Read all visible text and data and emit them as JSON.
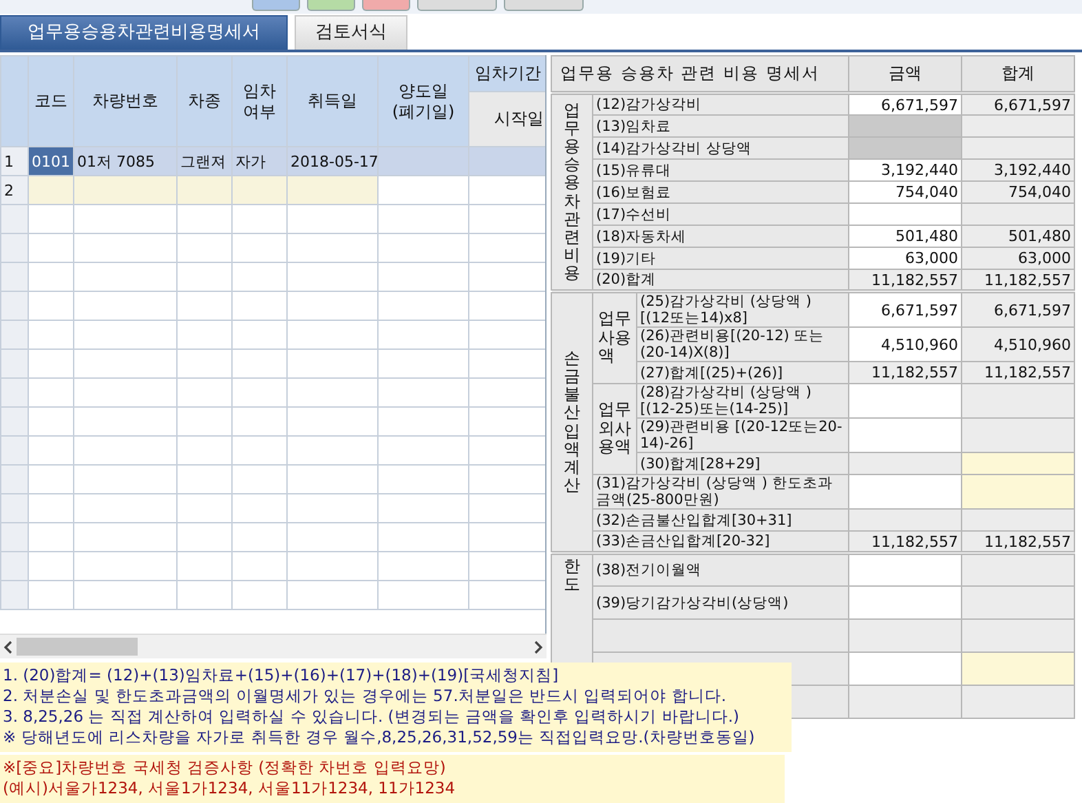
{
  "tabs": [
    {
      "label": "업무용승용차관련비용명세서",
      "selected": true
    },
    {
      "label": "검토서식",
      "selected": false
    }
  ],
  "vehicle_grid": {
    "columns": [
      "코드",
      "차량번호",
      "차종",
      "임차여부",
      "취득일",
      "양도일 (폐기일)"
    ],
    "column_group": {
      "label": "임차기간",
      "columns": [
        "시작일"
      ]
    },
    "rows": [
      {
        "number": "1",
        "selected": true,
        "new": false,
        "cells": [
          "0101",
          "01저 7085",
          "그랜져",
          "자가",
          "2018-05-17"
        ]
      },
      {
        "number": "2",
        "selected": false,
        "new": true
      }
    ]
  },
  "expense_table": {
    "title": "업무용 승용차 관련 비용 명세서",
    "columns": [
      "금액",
      "합계"
    ],
    "sections": [
      {
        "label": "업무용 승용차 관련 비용",
        "items": [
          {
            "label": "(12)감가상각비",
            "amount": {
              "kind": "input",
              "value": "6,671,597"
            },
            "total": {
              "kind": "calc",
              "value": "6,671,597"
            }
          },
          {
            "label": "(13)임차료",
            "amount": {
              "kind": "locked"
            },
            "total": {
              "kind": "calc"
            }
          },
          {
            "label": "(14)감가상각비 상당액",
            "amount": {
              "kind": "locked"
            },
            "total": {
              "kind": "calc"
            }
          },
          {
            "label": "(15)유류대",
            "amount": {
              "kind": "input",
              "value": "3,192,440"
            },
            "total": {
              "kind": "calc",
              "value": "3,192,440"
            }
          },
          {
            "label": "(16)보험료",
            "amount": {
              "kind": "input",
              "value": "754,040"
            },
            "total": {
              "kind": "calc",
              "value": "754,040"
            }
          },
          {
            "label": "(17)수선비",
            "amount": {
              "kind": "input"
            },
            "total": {
              "kind": "calc"
            }
          },
          {
            "label": "(18)자동차세",
            "amount": {
              "kind": "input",
              "value": "501,480"
            },
            "total": {
              "kind": "calc",
              "value": "501,480"
            }
          },
          {
            "label": "(19)기타",
            "amount": {
              "kind": "input",
              "value": "63,000"
            },
            "total": {
              "kind": "calc",
              "value": "63,000"
            }
          },
          {
            "label": "(20)합계",
            "amount": {
              "kind": "calc",
              "value": "11,182,557"
            },
            "total": {
              "kind": "calc",
              "value": "11,182,557"
            }
          }
        ]
      },
      {
        "label": "손금 불산입액 계산",
        "items": [
          {
            "label": "업무사용액",
            "rows": [
              {
                "label": "(25)감가상각비 (상당액 ) [(12또는14)x8]",
                "amount": {
                  "kind": "input",
                  "value": "6,671,597"
                },
                "total": {
                  "kind": "calc",
                  "value": "6,671,597"
                }
              },
              {
                "label": "(26)관련비용[(20-12) 또는(20-14)X(8)]",
                "amount": {
                  "kind": "input",
                  "value": "4,510,960"
                },
                "total": {
                  "kind": "calc",
                  "value": "4,510,960"
                }
              },
              {
                "label": "(27)합계[(25)+(26)]",
                "amount": {
                  "kind": "calc",
                  "value": "11,182,557"
                },
                "total": {
                  "kind": "calc",
                  "value": "11,182,557"
                }
              }
            ]
          },
          {
            "label": "업무외사용액",
            "rows": [
              {
                "label": "(28)감가상각비 (상당액 ) [(12-25)또는(14-25)]",
                "amount": {
                  "kind": "input"
                },
                "total": {
                  "kind": "calc"
                }
              },
              {
                "label": "(29)관련비용 [(20-12또는20-14)-26]",
                "amount": {
                  "kind": "input"
                },
                "total": {
                  "kind": "calc"
                }
              },
              {
                "label": "(30)합계[28+29]",
                "amount": {
                  "kind": "calc"
                },
                "total": {
                  "kind": "highlight"
                }
              }
            ]
          },
          {
            "label": "(31)감가상각비 (상당액 ) 한도초과금액(25-800만원)",
            "amount": {
              "kind": "input"
            },
            "total": {
              "kind": "highlight"
            }
          },
          {
            "label": "(32)손금불산입합계[30+31]",
            "amount": {
              "kind": "calc"
            },
            "total": {
              "kind": "calc"
            }
          },
          {
            "label": "(33)손금산입합계[20-32]",
            "amount": {
              "kind": "calc",
              "value": "11,182,557"
            },
            "total": {
              "kind": "calc",
              "value": "11,182,557"
            }
          }
        ]
      },
      {
        "label": "한도",
        "items": [
          {
            "label": "(38)전기이월액",
            "amount": {
              "kind": "input"
            },
            "total": {
              "kind": "calc"
            }
          },
          {
            "label": "(39)당기감가상각비(상당액)",
            "amount": {
              "kind": "input"
            },
            "total": {
              "kind": "calc"
            }
          },
          {
            "amount": {
              "kind": "calc"
            },
            "total": {
              "kind": "calc"
            }
          },
          {
            "amount": {
              "kind": "input"
            },
            "total": {
              "kind": "highlight"
            }
          },
          {
            "amount": {
              "kind": "calc"
            },
            "total": {
              "kind": "calc"
            }
          }
        ]
      }
    ]
  },
  "notes": [
    {
      "kind": "info",
      "lines": [
        "1. (20)합계= (12)+(13)임차료+(15)+(16)+(17)+(18)+(19)[국세청지침]",
        "2. 처분손실 및 한도초과금액의 이월명세가 있는 경우에는 57.처분일은 반드시 입력되어야 합니다.",
        "3. 8,25,26 는 직접 계산하여 입력하실 수 있습니다. (변경되는 금액을 확인후 입력하시기 바랍니다.)",
        "※ 당해년도에 리스차량을 자가로 취득한 경우 월수,8,25,26,31,52,59는 직접입력요망.(차량번호동일)"
      ]
    },
    {
      "kind": "warning",
      "lines": [
        "※[중요]차량번호 국세청 검증사항 (정확한 차번호 입력요망)",
        "(예시)서울가1234, 서울1가1234, 서울11가1234, 11가1234"
      ]
    }
  ]
}
